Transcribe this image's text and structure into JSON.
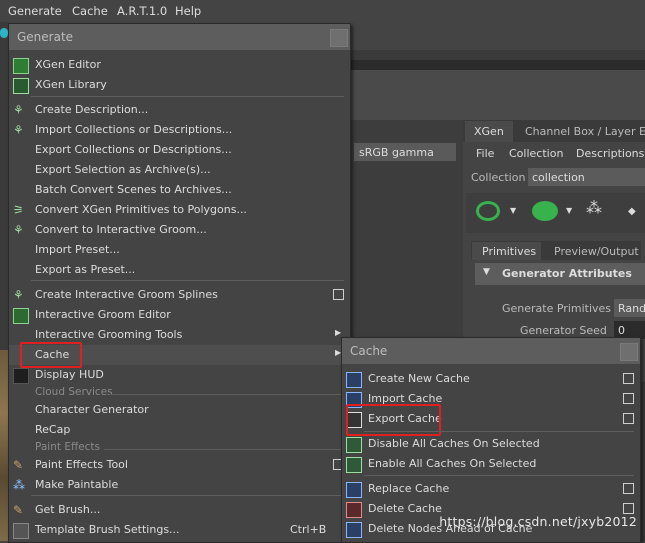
{
  "menubar": {
    "items": [
      "Generate",
      "Cache",
      "A.R.T.1.0",
      "Help"
    ]
  },
  "background": {
    "tabs": [
      "XGen",
      "Channel Box / Layer Edit"
    ],
    "menu": [
      "File",
      "Collection",
      "Descriptions"
    ],
    "collection_label": "Collection",
    "collection_value": "collection",
    "subtabs": [
      "Primitives",
      "Preview/Output"
    ],
    "section": "Generator Attributes",
    "fields": [
      {
        "label": "Generate Primitives",
        "value": "Rand"
      },
      {
        "label": "Generator Seed",
        "value": "0"
      }
    ],
    "color_space": "sRGB gamma"
  },
  "generate_menu": {
    "title": "Generate",
    "items": [
      {
        "label": "XGen Editor",
        "icon": "xgen-editor-icon"
      },
      {
        "label": "XGen Library",
        "icon": "xgen-library-icon"
      },
      {
        "label": "Create Description...",
        "icon": "create-description-icon"
      },
      {
        "label": "Import Collections or Descriptions...",
        "icon": "import-collections-icon"
      },
      {
        "label": "Export Collections or Descriptions...",
        "icon": "none"
      },
      {
        "label": "Export Selection as Archive(s)...",
        "icon": "none"
      },
      {
        "label": "Batch Convert Scenes to Archives...",
        "icon": "none"
      },
      {
        "label": "Convert XGen Primitives to Polygons...",
        "icon": "convert-polygons-icon"
      },
      {
        "label": "Convert to Interactive Groom...",
        "icon": "convert-groom-icon"
      },
      {
        "label": "Import Preset...",
        "icon": "none"
      },
      {
        "label": "Export as Preset...",
        "icon": "none"
      },
      {
        "label": "Create Interactive Groom Splines",
        "icon": "groom-splines-icon"
      },
      {
        "label": "Interactive Groom Editor",
        "icon": "groom-editor-icon"
      },
      {
        "label": "Interactive Grooming Tools",
        "icon": "none"
      },
      {
        "label": "Cache",
        "icon": "none"
      },
      {
        "label": "Display HUD",
        "icon": "display-hud-icon"
      },
      {
        "label": "Character Generator",
        "icon": "none"
      },
      {
        "label": "ReCap",
        "icon": "none"
      },
      {
        "label": "Paint Effects Tool",
        "icon": "paint-effects-icon"
      },
      {
        "label": "Make Paintable",
        "icon": "make-paintable-icon"
      },
      {
        "label": "Get Brush...",
        "icon": "get-brush-icon"
      },
      {
        "label": "Template Brush Settings...",
        "icon": "template-brush-icon",
        "shortcut": "Ctrl+B"
      }
    ],
    "sections": [
      "Cloud Services",
      "Paint Effects"
    ]
  },
  "cache_menu": {
    "title": "Cache",
    "items": [
      {
        "label": "Create New Cache",
        "icon": "create-cache-icon"
      },
      {
        "label": "Import Cache",
        "icon": "import-cache-icon"
      },
      {
        "label": "Export Cache",
        "icon": "export-cache-icon"
      },
      {
        "label": "Disable All Caches On Selected",
        "icon": "disable-cache-icon"
      },
      {
        "label": "Enable All Caches On Selected",
        "icon": "enable-cache-icon"
      },
      {
        "label": "Replace Cache",
        "icon": "replace-cache-icon"
      },
      {
        "label": "Delete Cache",
        "icon": "delete-cache-icon"
      },
      {
        "label": "Delete Nodes Ahead of Cache",
        "icon": "delete-nodes-icon"
      }
    ]
  },
  "watermark": "https://blog.csdn.net/jxyb2012",
  "colors": {
    "highlight": "#e02020",
    "menu_bg": "#444444",
    "title_bg": "#5d5d5d"
  }
}
